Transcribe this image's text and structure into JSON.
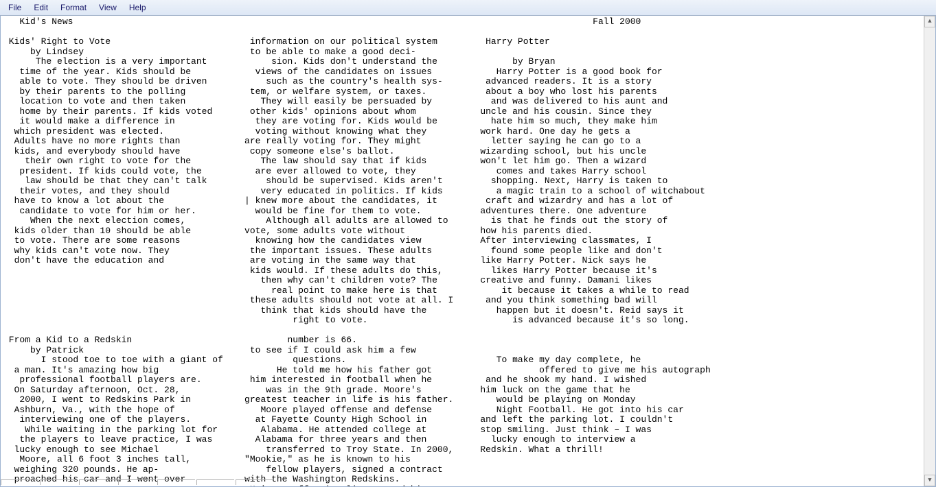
{
  "menu": {
    "file": "File",
    "edit": "Edit",
    "format": "Format",
    "view": "View",
    "help": "Help"
  },
  "doc": {
    "header_left": " Kid's News",
    "header_right": "Fall 2000",
    "article1_title": "Kids' Right to Vote",
    "article1_byline": "    by Lindsey",
    "col1": [
      "     The election is a very important",
      "  time of the year. Kids should be",
      "  able to vote. They should be driven",
      "  by their parents to the polling",
      "  location to vote and then taken",
      "  home by their parents. If kids voted",
      "  it would make a difference in",
      " which president was elected.",
      " Adults have no more rights than",
      " kids, and everybody should have",
      "   their own right to vote for the",
      "  president. If kids could vote, the",
      "   law should be that they can't talk",
      "  their votes, and they should",
      " have to know a lot about the",
      "  candidate to vote for him or her.",
      "    When the next election comes,",
      " kids older than 10 should be able",
      " to vote. There are some reasons",
      " why kids can't vote now. They",
      " don't have the education and"
    ],
    "col2_top": "  information on our political system",
    "col2": [
      "  to be able to make a good deci-",
      "      sion. Kids don't understand the",
      "   views of the candidates on issues",
      "     such as the country's health sys-",
      "  tem, or welfare system, or taxes.",
      "    They will easily be persuaded by",
      "  other kids' opinions about whom",
      "   they are voting for. Kids would be",
      "   voting without knowing what they",
      " are really voting for. They might",
      "  copy someone else's ballot.",
      "    The law should say that if kids",
      "   are ever allowed to vote, they",
      "     should be supervised. Kids aren't",
      "    very educated in politics. If kids",
      " | knew more about the candidates, it",
      "   would be fine for them to vote.",
      "     Although all adults are allowed to",
      " vote, some adults vote without",
      "   knowing how the candidates view",
      "  the important issues. These adults",
      "  are voting in the same way that",
      "  kids would. If these adults do this,",
      "    then why can't children vote? The",
      "      real point to make here is that",
      "  these adults should not vote at all. I",
      "    think that kids should have the",
      "          right to vote."
    ],
    "col3_top": "  Harry Potter",
    "col3_byline": "       by Bryan",
    "col3": [
      "    Harry Potter is a good book for",
      "  advanced readers. It is a story",
      "  about a boy who lost his parents",
      "   and was delivered to his aunt and",
      " uncle and his cousin. Since they",
      "   hate him so much, they make him",
      " work hard. One day he gets a",
      "   letter saying he can go to a",
      " wizarding school, but his uncle",
      " won't let him go. Then a wizard",
      "    comes and takes Harry school",
      "   shopping. Next, Harry is taken to",
      "    a magic train to a school of witchabout",
      "  craft and wizardry and has a lot of",
      " adventures there. One adventure",
      "   is that he finds out the story of",
      " how his parents died.",
      " After interviewing classmates, I",
      "   found some people like and don't",
      " like Harry Potter. Nick says he",
      "   likes Harry Potter because it's",
      " creative and funny. Damani likes",
      "     it because it takes a while to read",
      "  and you think something bad will",
      "    happen but it doesn't. Reid says it",
      "       is advanced because it's so long."
    ],
    "article2_title": "From a Kid to a Redskin",
    "article2_byline": "    by Patrick",
    "b_col1": [
      "      I stood toe to toe with a giant of",
      " a man. It's amazing how big",
      "  professional football players are.",
      " On Saturday afternoon, Oct. 28,",
      "  2000, I went to Redskins Park in",
      " Ashburn, Va., with the hope of",
      "  interviewing one of the players.",
      "   While waiting in the parking lot for",
      "  the players to leave practice, I was",
      " lucky enough to see Michael",
      "  Moore, all 6 foot 3 inches tall,",
      " weighing 320 pounds. He ap-",
      " proached his car and I went over"
    ],
    "b_col2_top": "         number is 66.",
    "b_col2": [
      "  to see if I could ask him a few",
      "          questions.",
      "       He told me how his father got",
      "  him interested in football when he",
      "     was in the 9th grade. Moore's",
      " greatest teacher in life is his father.",
      "    Moore played offense and defense",
      "   at Fayette County High School in",
      "    Alabama. He attended college at",
      "   Alabama for three years and then",
      "     transferred to Troy State. In 2000,",
      " \"Mookie,\" as he is known to his",
      "     fellow players, signed a contract",
      " with the Washington Redskins.",
      "  He's an offensive lineman and his"
    ],
    "b_col3": [
      "    To make my day complete, he",
      "            offered to give me his autograph",
      "  and he shook my hand. I wished",
      " him luck on the game that he",
      "    would be playing on Monday",
      "    Night Football. He got into his car",
      " and left the parking lot. I couldn't",
      " stop smiling. Just think – I was",
      "   lucky enough to interview a",
      " Redskin. What a thrill!"
    ]
  }
}
